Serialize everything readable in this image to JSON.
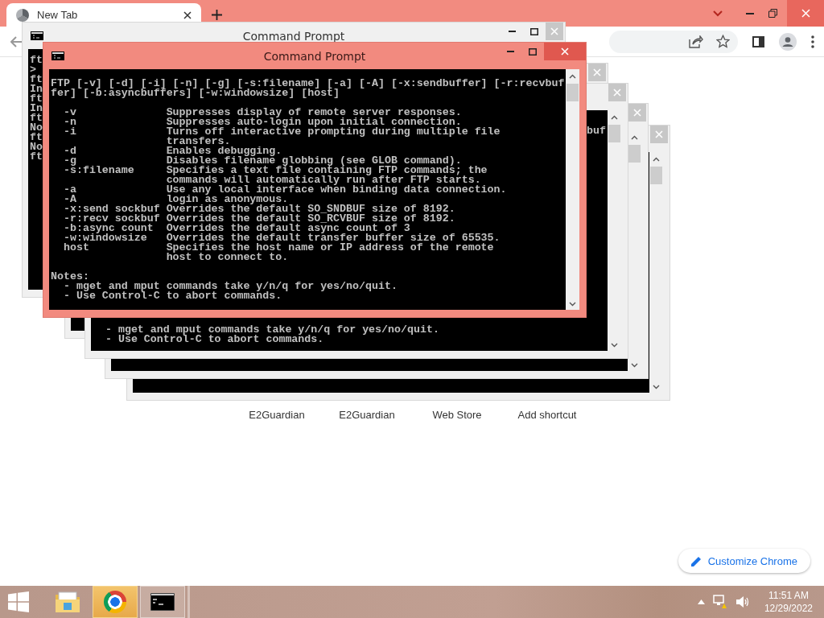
{
  "tab": {
    "title": "New Tab",
    "selected": true
  },
  "shortcuts": [
    {
      "label": "E2Guardian"
    },
    {
      "label": "E2Guardian"
    },
    {
      "label": "Web Store"
    },
    {
      "label": "Add shortcut"
    }
  ],
  "customize_button": {
    "label": "Customize Chrome"
  },
  "windows": [
    {
      "focused": false
    },
    {
      "focused": false
    },
    {
      "focused": false
    },
    {
      "focused": false,
      "top_right_lines": [
        "buf"
      ],
      "bottom_lines": [
        "  - mget and mput commands take y/n/q for yes/no/quit.",
        "  - Use Control-C to abort commands."
      ]
    },
    {
      "focused": false,
      "title": "Command Prompt",
      "top_lines": [
        "ft",
        ">",
        "ft",
        "In",
        "ft",
        "In",
        "ft",
        "No",
        "ft",
        "No",
        "ft"
      ]
    },
    {
      "focused": true,
      "title": "Command Prompt",
      "paragraphs": [
        [
          "FTP [-v] [-d] [-i] [-n] [-g] [-s:filename] [-a] [-A] [-x:sendbuffer] [-r:recvbuf",
          "fer] [-b:asyncbuffers] [-w:windowsize] [host]"
        ],
        [
          "  -v              Suppresses display of remote server responses.",
          "  -n              Suppresses auto-login upon initial connection.",
          "  -i              Turns off interactive prompting during multiple file",
          "                  transfers.",
          "  -d              Enables debugging.",
          "  -g              Disables filename globbing (see GLOB command).",
          "  -s:filename     Specifies a text file containing FTP commands; the",
          "                  commands will automatically run after FTP starts.",
          "  -a              Use any local interface when binding data connection.",
          "  -A              login as anonymous.",
          "  -x:send sockbuf Overrides the default SO_SNDBUF size of 8192.",
          "  -r:recv sockbuf Overrides the default SO_RCVBUF size of 8192.",
          "  -b:async count  Overrides the default async count of 3",
          "  -w:windowsize   Overrides the default transfer buffer size of 65535.",
          "  host            Specifies the host name or IP address of the remote",
          "                  host to connect to."
        ],
        [
          "Notes:",
          "  - mget and mput commands take y/n/q for yes/no/quit.",
          "  - Use Control-C to abort commands."
        ]
      ]
    }
  ],
  "taskbar": {
    "apps": [
      {
        "kind": "explorer",
        "selected": false,
        "running": false
      },
      {
        "kind": "chrome",
        "selected": true,
        "running": true
      },
      {
        "kind": "console",
        "selected": false,
        "running": true
      }
    ],
    "time": "11:51 AM",
    "date": "12/29/2022"
  }
}
